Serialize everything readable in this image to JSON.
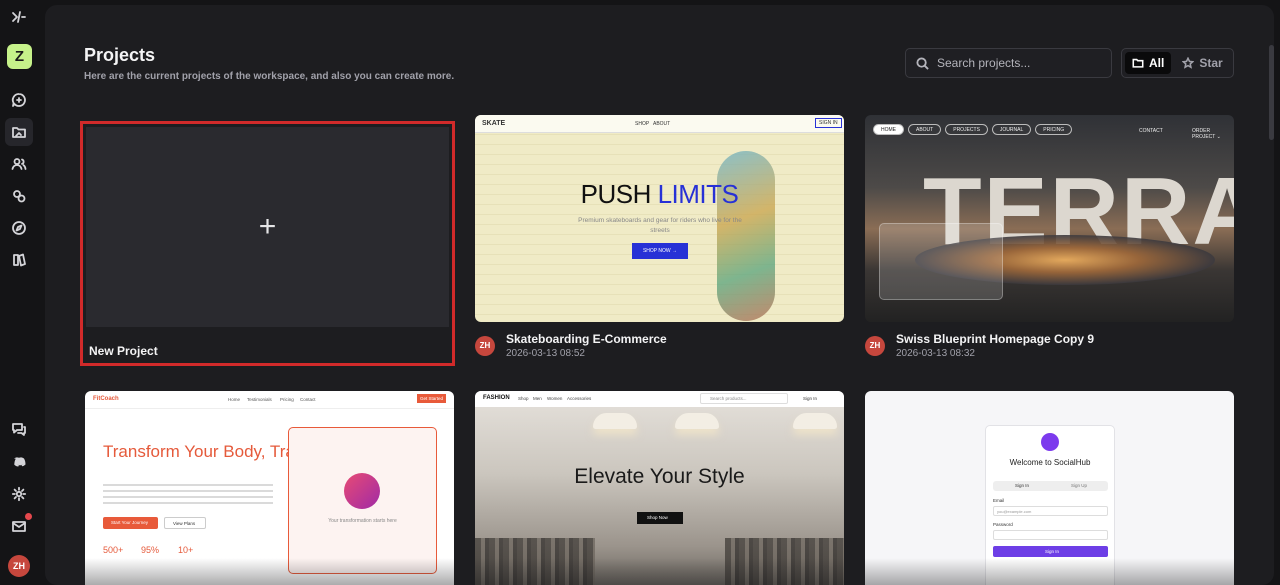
{
  "sidebar": {
    "workspace_initial": "Z",
    "user_initials": "ZH"
  },
  "header": {
    "title": "Projects",
    "subtitle": "Here are the current projects of the workspace, and also you can create more.",
    "search_placeholder": "Search projects...",
    "filter": {
      "all_label": "All",
      "star_label": "Star",
      "selected": "All"
    }
  },
  "new_project": {
    "label": "New Project"
  },
  "projects": [
    {
      "title": "Skateboarding E-Commerce",
      "date": "2026-03-13 08:52",
      "owner": "ZH",
      "preview": {
        "brand": "SKATE",
        "nav": [
          "SHOP",
          "ABOUT"
        ],
        "headline_a": "PUSH",
        "headline_b": "LIMITS",
        "sub": "Premium skateboards and gear for riders who live for the streets",
        "cta": "SHOP NOW →",
        "signin": "SIGN IN"
      }
    },
    {
      "title": "Swiss Blueprint Homepage Copy 9",
      "date": "2026-03-13 08:32",
      "owner": "ZH",
      "preview": {
        "nav": [
          "HOME",
          "ABOUT",
          "PROJECTS",
          "JOURNAL",
          "PRICING"
        ],
        "right": [
          "CONTACT",
          "ORDER PROJECT ⌄"
        ],
        "word": "TERRA"
      }
    },
    {
      "title": "",
      "date": "",
      "owner": "",
      "preview": {
        "brand": "FitCoach",
        "nav": [
          "Home",
          "Testimonials",
          "Pricing",
          "Contact"
        ],
        "cta": "Get Started",
        "headline": "Transform Your Body, Transform Your Life",
        "btn1": "Start Your Journey",
        "btn2": "View Plans",
        "stats": [
          "500+",
          "95%",
          "10+"
        ],
        "panel_caption": "Your transformation starts here"
      }
    },
    {
      "title": "",
      "date": "",
      "owner": "",
      "preview": {
        "brand": "FASHION",
        "nav": [
          "Shop",
          "Men",
          "Women",
          "Accessories"
        ],
        "search": "Search products...",
        "signin": "Sign In",
        "headline": "Elevate Your Style",
        "cta": "Shop Now"
      }
    },
    {
      "title": "",
      "date": "",
      "owner": "",
      "preview": {
        "title": "Welcome to SocialHub",
        "tabs": [
          "Sign In",
          "Sign Up"
        ],
        "email_label": "Email",
        "email_placeholder": "you@example.com",
        "password_label": "Password",
        "submit": "Sign In"
      }
    }
  ],
  "colors": {
    "accent_avatar": "#c6f28a",
    "owner_avatar": "#c6473d",
    "selection_border": "#d12a2a"
  }
}
